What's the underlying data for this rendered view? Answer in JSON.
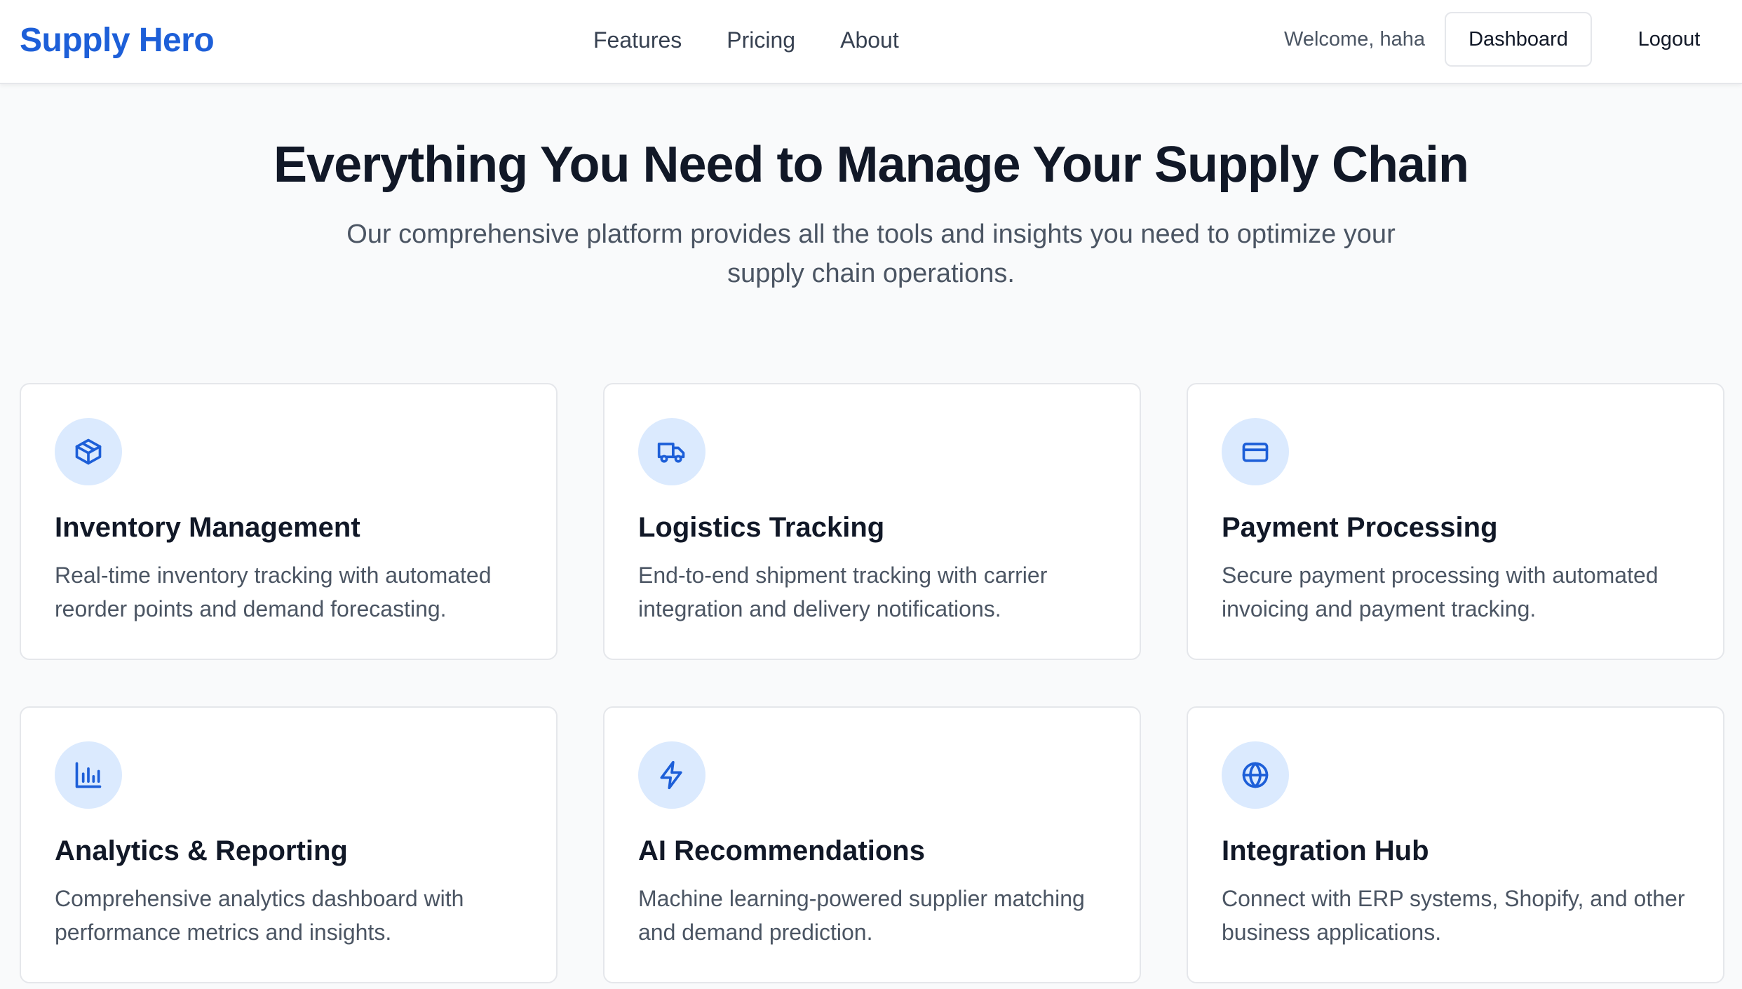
{
  "brand": {
    "name": "Supply Hero",
    "color": "#1d5fd8"
  },
  "nav": {
    "links": [
      "Features",
      "Pricing",
      "About"
    ],
    "welcome": "Welcome, haha",
    "dashboard_label": "Dashboard",
    "logout_label": "Logout"
  },
  "hero": {
    "title": "Everything You Need to Manage Your Supply Chain",
    "subtitle": "Our comprehensive platform provides all the tools and insights you need to optimize your supply chain operations."
  },
  "features": [
    {
      "icon": "package-icon",
      "title": "Inventory Management",
      "description": "Real-time inventory tracking with automated reorder points and demand forecasting."
    },
    {
      "icon": "truck-icon",
      "title": "Logistics Tracking",
      "description": "End-to-end shipment tracking with carrier integration and delivery notifications."
    },
    {
      "icon": "credit-card-icon",
      "title": "Payment Processing",
      "description": "Secure payment processing with automated invoicing and payment tracking."
    },
    {
      "icon": "bar-chart-icon",
      "title": "Analytics & Reporting",
      "description": "Comprehensive analytics dashboard with performance metrics and insights."
    },
    {
      "icon": "lightning-icon",
      "title": "AI Recommendations",
      "description": "Machine learning-powered supplier matching and demand prediction."
    },
    {
      "icon": "globe-icon",
      "title": "Integration Hub",
      "description": "Connect with ERP systems, Shopify, and other business applications."
    }
  ],
  "colors": {
    "accent": "#1d5fd8",
    "icon_bg": "#dbeafe",
    "text": "#111827",
    "muted": "#4b5563"
  }
}
